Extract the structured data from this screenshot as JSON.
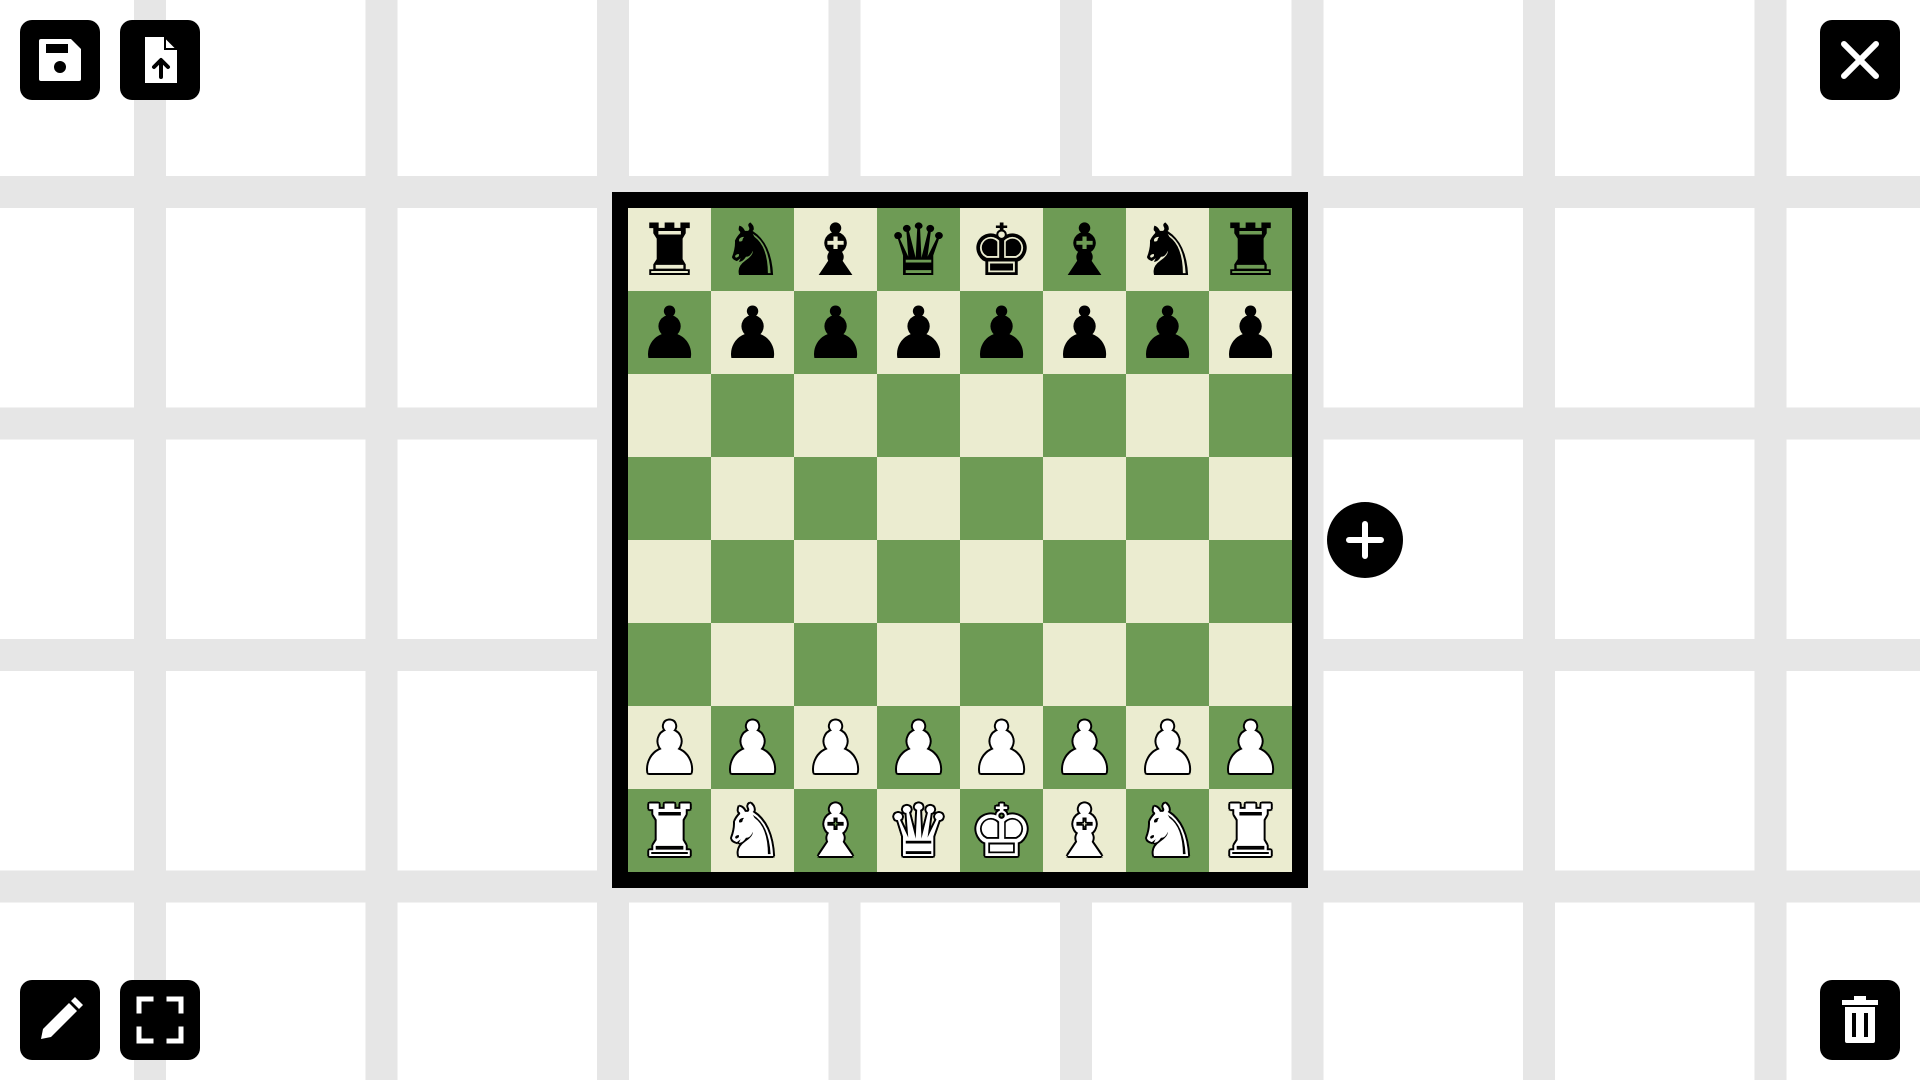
{
  "toolbar": {
    "top_left": [
      {
        "name": "save-button",
        "icon": "save-icon"
      },
      {
        "name": "export-button",
        "icon": "file-upload-icon"
      }
    ],
    "top_right": [
      {
        "name": "close-button",
        "icon": "close-icon"
      }
    ],
    "bottom_left": [
      {
        "name": "edit-button",
        "icon": "pencil-icon"
      },
      {
        "name": "fullscreen-button",
        "icon": "fullscreen-icon"
      }
    ],
    "bottom_right": [
      {
        "name": "delete-button",
        "icon": "trash-icon"
      }
    ]
  },
  "add_button": {
    "icon": "plus-icon"
  },
  "board": {
    "colors": {
      "light": "#ebecd0",
      "dark": "#6e9b55",
      "border": "#000000"
    },
    "ranks": [
      [
        "r",
        "n",
        "b",
        "q",
        "k",
        "b",
        "n",
        "r"
      ],
      [
        "p",
        "p",
        "p",
        "p",
        "p",
        "p",
        "p",
        "p"
      ],
      [
        "",
        "",
        "",
        "",
        "",
        "",
        "",
        ""
      ],
      [
        "",
        "",
        "",
        "",
        "",
        "",
        "",
        ""
      ],
      [
        "",
        "",
        "",
        "",
        "",
        "",
        "",
        ""
      ],
      [
        "",
        "",
        "",
        "",
        "",
        "",
        "",
        ""
      ],
      [
        "P",
        "P",
        "P",
        "P",
        "P",
        "P",
        "P",
        "P"
      ],
      [
        "R",
        "N",
        "B",
        "Q",
        "K",
        "B",
        "N",
        "R"
      ]
    ]
  },
  "piece_glyphs": {
    "r": "♜",
    "n": "♞",
    "b": "♝",
    "q": "♛",
    "k": "♚",
    "p": "♟",
    "R": "♜",
    "N": "♞",
    "B": "♝",
    "Q": "♛",
    "K": "♚",
    "P": "♟"
  },
  "piece_names": {
    "r": "black-rook",
    "n": "black-knight",
    "b": "black-bishop",
    "q": "black-queen",
    "k": "black-king",
    "p": "black-pawn",
    "R": "white-rook",
    "N": "white-knight",
    "B": "white-bishop",
    "Q": "white-queen",
    "K": "white-king",
    "P": "white-pawn"
  }
}
